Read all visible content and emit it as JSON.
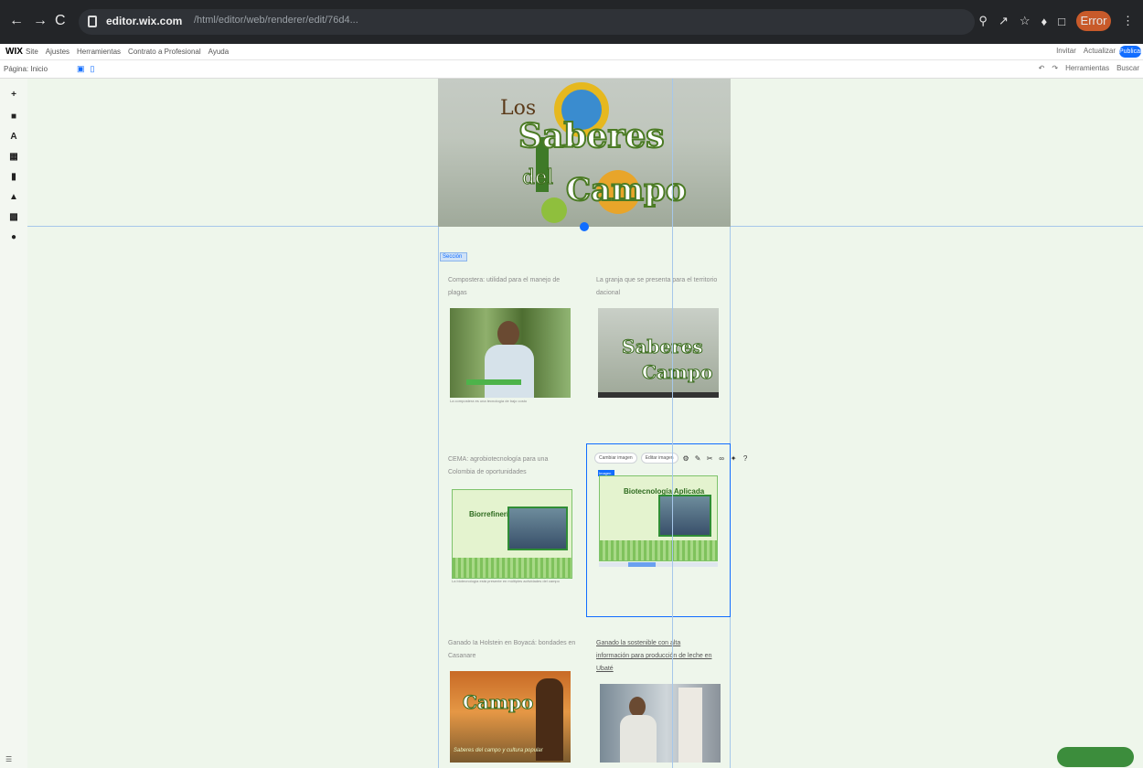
{
  "browser": {
    "back": "←",
    "forward": "→",
    "reload": "C",
    "url_host": "editor.wix.com",
    "url_path": "/html/editor/web/renderer/edit/76d4...",
    "profile_label": "Error"
  },
  "wix_menu": {
    "logo": "WIX",
    "items": [
      "Site",
      "Ajustes",
      "Herramientas",
      "Contrato a Profesional",
      "Ayuda"
    ],
    "right_items": [
      "Invitar",
      "Actualizar"
    ],
    "publish": "Publicar"
  },
  "toolbar": {
    "page": "Página: Inicio",
    "right_items": [
      "Herramientas",
      "Buscar"
    ]
  },
  "header": {
    "logo_los": "Los",
    "logo_saberes": "Saberes",
    "logo_del": "del",
    "logo_campo": "Campo"
  },
  "section_tag": "Sección",
  "cards": [
    {
      "title": "Compostera: utilidad para el manejo de plagas",
      "caption": "La compostera es una tecnología de bajo costo"
    },
    {
      "title": "La granja que se presenta para el territorio dacional",
      "caption": ""
    },
    {
      "title": "CEMA: agrobiotecnología para una Colombia de oportunidades",
      "caption": "La biotecnología está presente en múltiples actividades del campo"
    },
    {
      "title": "",
      "caption": ""
    },
    {
      "title": "Ganado Ia Holstein en Boyacá: bondades en Casanare",
      "caption": ""
    },
    {
      "title": "Ganado la sostenible con alta información para producción de leche en Ubaté",
      "caption": ""
    }
  ],
  "slide1": {
    "title": "Biorrefinería Orgánica"
  },
  "slide2": {
    "title": "Biotecnología Aplicada"
  },
  "card5_logo": "Campo",
  "card5_tagline": "Saberes del campo y cultura popular",
  "float_toolbar": {
    "change_image": "Cambiar imagen",
    "edit_image": "Editar imagen"
  },
  "selected_label": "Imagen"
}
